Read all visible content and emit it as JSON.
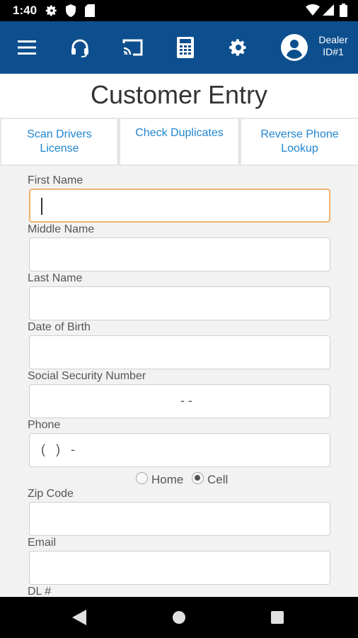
{
  "status_bar": {
    "time": "1:40",
    "icons": [
      "gear-icon",
      "shield-icon",
      "sim-card-icon",
      "wifi-icon",
      "signal-icon",
      "battery-icon"
    ]
  },
  "app_bar": {
    "color": "#0d4f8e",
    "icons": [
      "menu-icon",
      "headset-icon",
      "cast-icon",
      "calculator-icon",
      "settings-icon",
      "account-icon"
    ],
    "dealer_line1": "Dealer",
    "dealer_line2": "ID#1"
  },
  "page": {
    "title": "Customer Entry"
  },
  "actions": [
    {
      "label": "Scan Drivers License"
    },
    {
      "label": "Check Duplicates"
    },
    {
      "label": "Reverse Phone Lookup"
    }
  ],
  "form": {
    "first_name": {
      "label": "First Name",
      "value": ""
    },
    "middle_name": {
      "label": "Middle Name",
      "value": ""
    },
    "last_name": {
      "label": "Last Name",
      "value": ""
    },
    "dob": {
      "label": "Date of Birth",
      "value": ""
    },
    "ssn": {
      "label": "Social Security Number",
      "mask": "-  -"
    },
    "phone": {
      "label": "Phone",
      "mask": "(   )   -"
    },
    "phone_type": {
      "options": [
        "Home",
        "Cell"
      ],
      "selected": "Cell"
    },
    "zip": {
      "label": "Zip Code",
      "value": ""
    },
    "email": {
      "label": "Email",
      "value": ""
    },
    "dl": {
      "label": "DL #"
    }
  },
  "colors": {
    "accent_link": "#1f86d0",
    "focus_border": "#f0b36b"
  }
}
